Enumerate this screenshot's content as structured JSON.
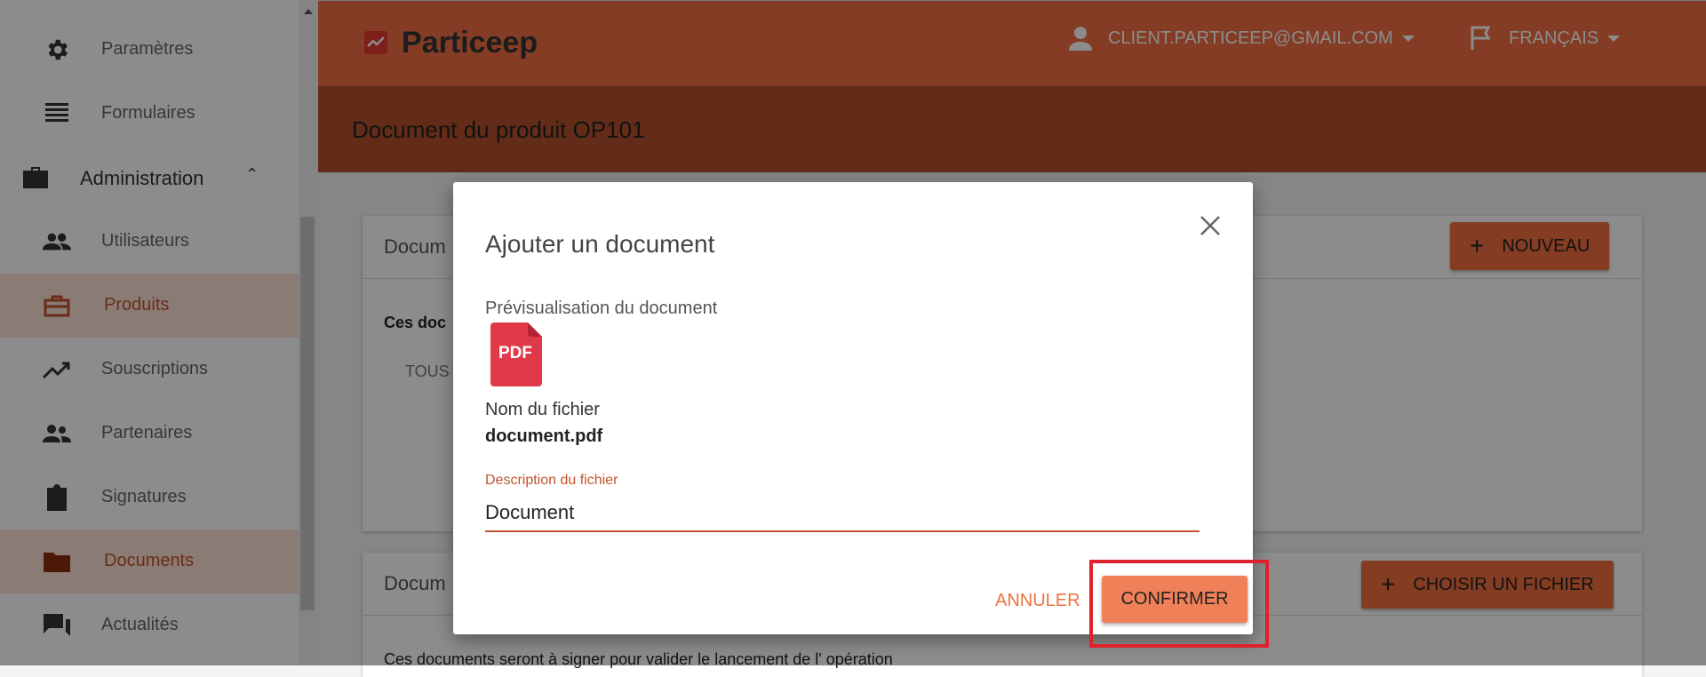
{
  "sidebar": {
    "items": [
      {
        "label": "Paramètres",
        "icon": "gear-icon"
      },
      {
        "label": "Formulaires",
        "icon": "list-icon"
      },
      {
        "label": "Administration",
        "icon": "briefcase-icon",
        "section": true
      },
      {
        "label": "Utilisateurs",
        "icon": "users-icon"
      },
      {
        "label": "Produits",
        "icon": "briefcase-outline-icon",
        "active": true
      },
      {
        "label": "Souscriptions",
        "icon": "trending-up-icon"
      },
      {
        "label": "Partenaires",
        "icon": "people-icon"
      },
      {
        "label": "Signatures",
        "icon": "clipboard-icon"
      },
      {
        "label": "Documents",
        "icon": "folder-icon",
        "active": true
      },
      {
        "label": "Actualités",
        "icon": "chat-icon"
      }
    ]
  },
  "header": {
    "brand": "Particeep",
    "user": "CLIENT.PARTICEEP@GMAIL.COM",
    "language": "FRANÇAIS",
    "accent": "#f06e42"
  },
  "page": {
    "title": "Document du produit OP101"
  },
  "cards": {
    "card1_title": "Docum",
    "card1_text": "Ces doc",
    "card1_tab": "TOUS",
    "new_button": "NOUVEAU",
    "card2_title": "Docum",
    "choose_button": "CHOISIR UN FICHIER",
    "card2_text": "Ces documents seront à signer pour valider le lancement de l' opération"
  },
  "modal": {
    "title": "Ajouter un document",
    "preview_label": "Prévisualisation du document",
    "file_icon_text": "PDF",
    "filename_label": "Nom du fichier",
    "filename": "document.pdf",
    "description_label": "Description du fichier",
    "description_value": "Document",
    "cancel_label": "ANNULER",
    "confirm_label": "CONFIRMER"
  }
}
